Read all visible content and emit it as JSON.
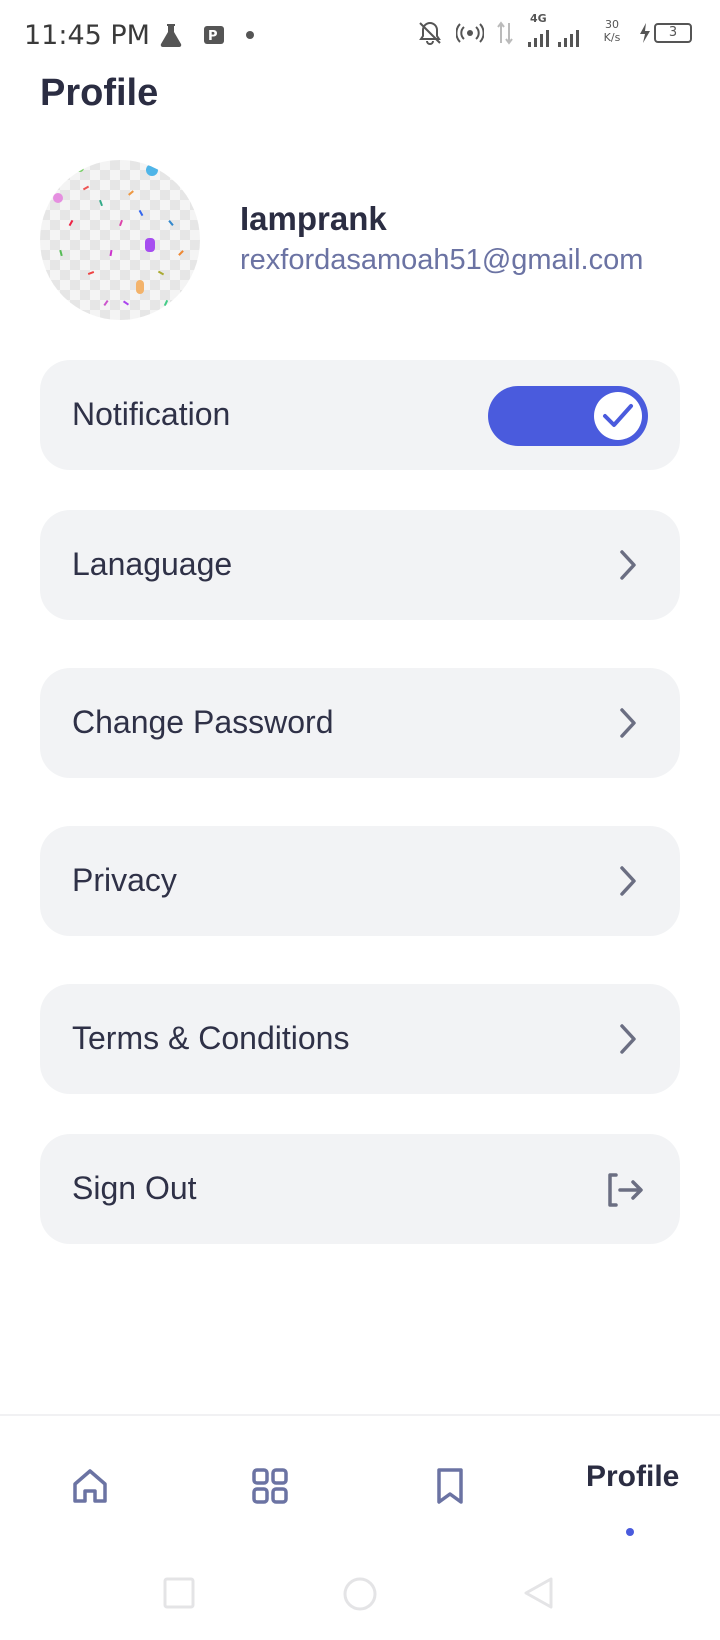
{
  "status_bar": {
    "time": "11:45 PM",
    "network": "4G",
    "speed_value": "30",
    "speed_unit": "K/s",
    "battery": "3"
  },
  "header": {
    "title": "Profile"
  },
  "user": {
    "name": "Iamprank",
    "email": "rexfordasamoah51@gmail.com"
  },
  "settings": {
    "notification": {
      "label": "Notification",
      "enabled": true
    },
    "language": {
      "label": "Lanaguage"
    },
    "change_password": {
      "label": "Change Password"
    },
    "privacy": {
      "label": "Privacy"
    },
    "terms": {
      "label": "Terms & Conditions"
    },
    "sign_out": {
      "label": "Sign Out"
    }
  },
  "bottom_nav": {
    "items": [
      {
        "icon": "home-icon"
      },
      {
        "icon": "grid-icon"
      },
      {
        "icon": "bookmark-icon"
      },
      {
        "label": "Profile",
        "active": true
      }
    ]
  },
  "colors": {
    "accent": "#4a5bdd",
    "card_bg": "#f2f3f5",
    "text": "#2b2d42",
    "email": "#6b73a3"
  }
}
